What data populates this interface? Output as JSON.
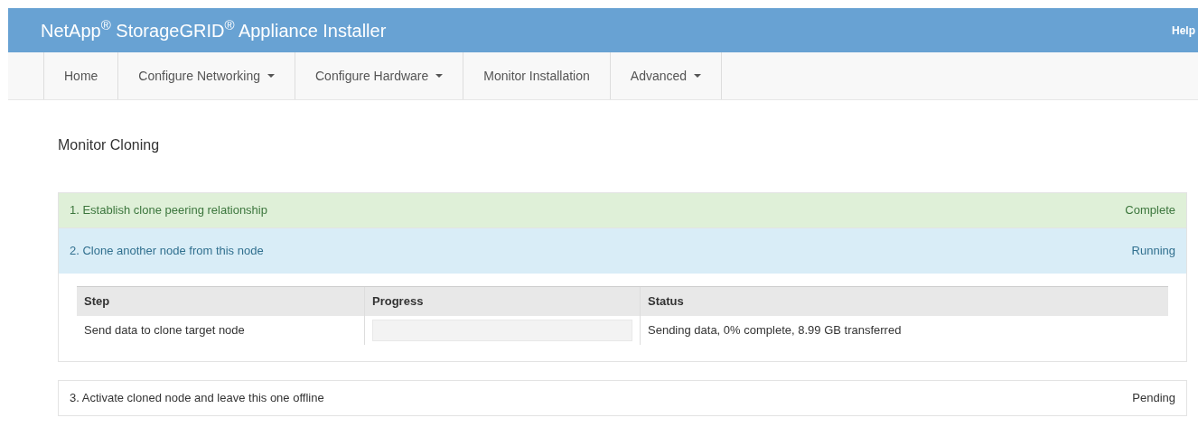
{
  "header": {
    "title": "NetApp$^{®}$ StorageGRID$^{®}$ Appliance Installer",
    "help": "Help"
  },
  "nav": [
    {
      "label": "Home",
      "dropdown": false
    },
    {
      "label": "Configure Networking",
      "dropdown": true
    },
    {
      "label": "Configure Hardware",
      "dropdown": true
    },
    {
      "label": "Monitor Installation",
      "dropdown": false
    },
    {
      "label": "Advanced",
      "dropdown": true
    }
  ],
  "page_title": "Monitor Cloning",
  "steps": [
    {
      "title": "1. Establish clone peering relationship",
      "status": "Complete",
      "kind": "complete"
    },
    {
      "title": "2. Clone another node from this node",
      "status": "Running",
      "kind": "running",
      "table": {
        "columns": [
          "Step",
          "Progress",
          "Status"
        ],
        "rows": [
          {
            "step": "Send data to clone target node",
            "level": 0,
            "status": "Sending data, 0% complete, 8.99 GB transferred"
          }
        ]
      }
    },
    {
      "title": "3. Activate cloned node and leave this one offline",
      "status": "Pending",
      "kind": "pending"
    }
  ]
}
